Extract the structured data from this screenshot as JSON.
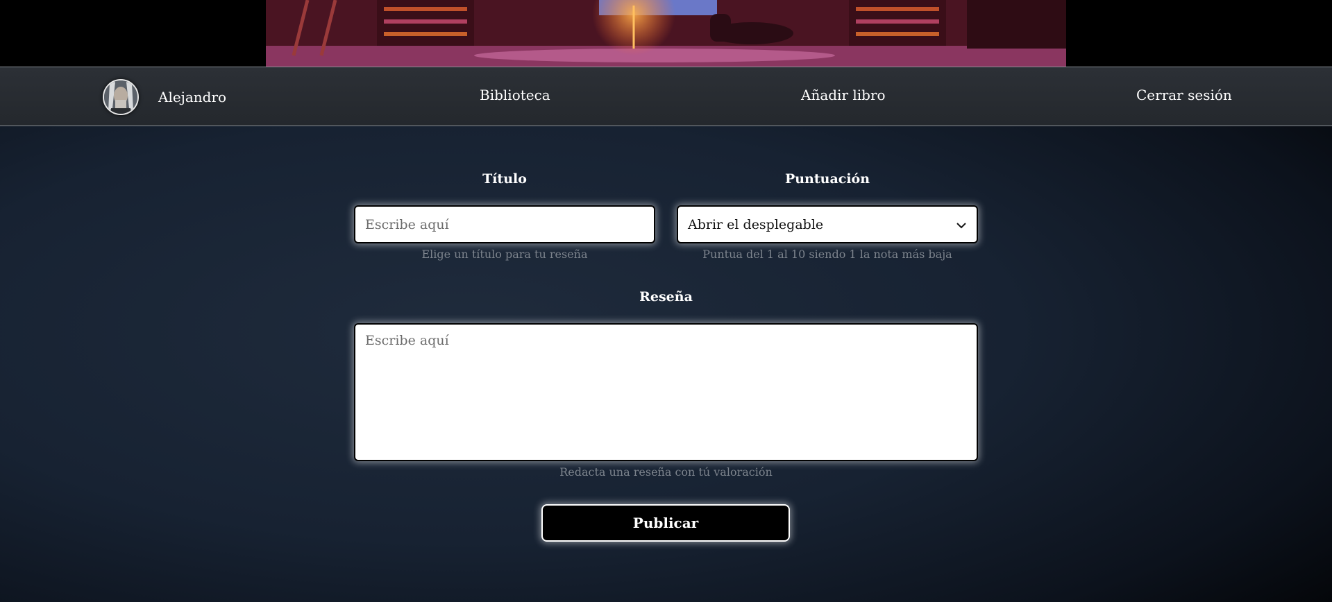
{
  "nav": {
    "username": "Alejandro",
    "links": {
      "library": "Biblioteca",
      "add_book": "Añadir libro",
      "logout": "Cerrar sesión"
    },
    "avatar_icon": "user-avatar-icon"
  },
  "form": {
    "title": {
      "label": "Título",
      "placeholder": "Escribe aquí",
      "hint": "Elige un título para tu reseña"
    },
    "score": {
      "label": "Puntuación",
      "selected": "Abrir el desplegable",
      "hint": "Puntua del 1 al 10 siendo 1 la nota más baja"
    },
    "review": {
      "label": "Reseña",
      "placeholder": "Escribe aquí",
      "hint": "Redacta una reseña con tú valoración"
    },
    "submit_label": "Publicar"
  },
  "colors": {
    "background": "#172232",
    "nav_background": "#2c3036",
    "hint_text": "#7d848d",
    "button_background": "#000000"
  }
}
